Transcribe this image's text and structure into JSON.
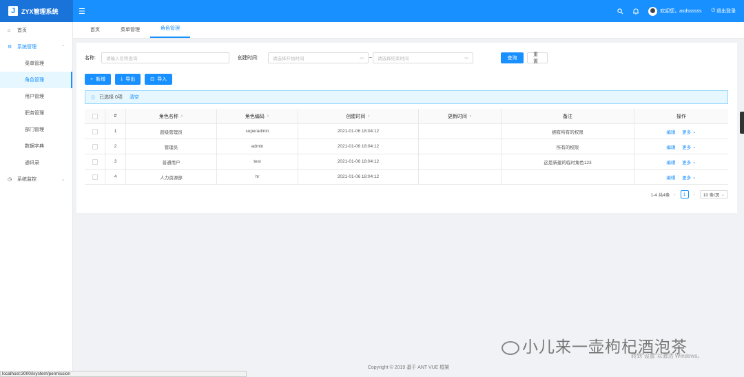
{
  "app": {
    "logo_letter": "J",
    "title": "ZYX管理系统",
    "menu_icon": "menu-fold-icon"
  },
  "header": {
    "search_icon": "⌕",
    "bell_icon": "🔔",
    "welcome": "欢迎您，asdssssss",
    "logout": "退出登录"
  },
  "sidebar": {
    "home": "首页",
    "system_manage": "系统管理",
    "sub": [
      "菜单管理",
      "角色管理",
      "用户管理",
      "职务管理",
      "部门管理",
      "数据字典",
      "通讯录"
    ],
    "system_monitor": "系统监控"
  },
  "tabs": [
    "首页",
    "菜单管理",
    "角色管理"
  ],
  "search": {
    "name_label": "名称:",
    "name_placeholder": "请输入名称查询",
    "created_label": "创建时间:",
    "start_placeholder": "请选择开始时间",
    "tilde": "~",
    "end_placeholder": "请选择结束时间",
    "query": "查询",
    "reset": "重置"
  },
  "toolbar": {
    "add": "新增",
    "export": "导出",
    "import": "导入"
  },
  "alert": {
    "selected": "已选择 0项",
    "clear": "清空"
  },
  "table": {
    "headers": [
      "#",
      "角色名称",
      "角色编码",
      "创建时间",
      "更新时间",
      "备注",
      "操作"
    ],
    "rows": [
      {
        "no": "1",
        "name": "超级管理员",
        "code": "superadmin",
        "created": "2021-01-06 18:04:12",
        "updated": "",
        "remark": "拥有所有的权限",
        "edit": "编辑",
        "more": "更多"
      },
      {
        "no": "2",
        "name": "管理员",
        "code": "admin",
        "created": "2021-01-06 18:04:12",
        "updated": "",
        "remark": "所有的权限",
        "edit": "编辑",
        "more": "更多"
      },
      {
        "no": "3",
        "name": "普通用户",
        "code": "test",
        "created": "2021-01-06 18:04:12",
        "updated": "",
        "remark": "这是新建的临时角色123",
        "edit": "编辑",
        "more": "更多"
      },
      {
        "no": "4",
        "name": "人力资源部",
        "code": "hr",
        "created": "2021-01-06 18:04:12",
        "updated": "",
        "remark": "",
        "edit": "编辑",
        "more": "更多"
      }
    ]
  },
  "pagination": {
    "summary": "1-4 共4条",
    "current": "1",
    "page_size": "10 条/页"
  },
  "footer": "Copyright © 2019 基于 ANT VUE 框架",
  "statusbar": "localhost:3000/isystem/permission",
  "watermark": "小儿来一壶枸杞酒泡茶",
  "activate": "转到\"设置\"以激活 Windows。"
}
